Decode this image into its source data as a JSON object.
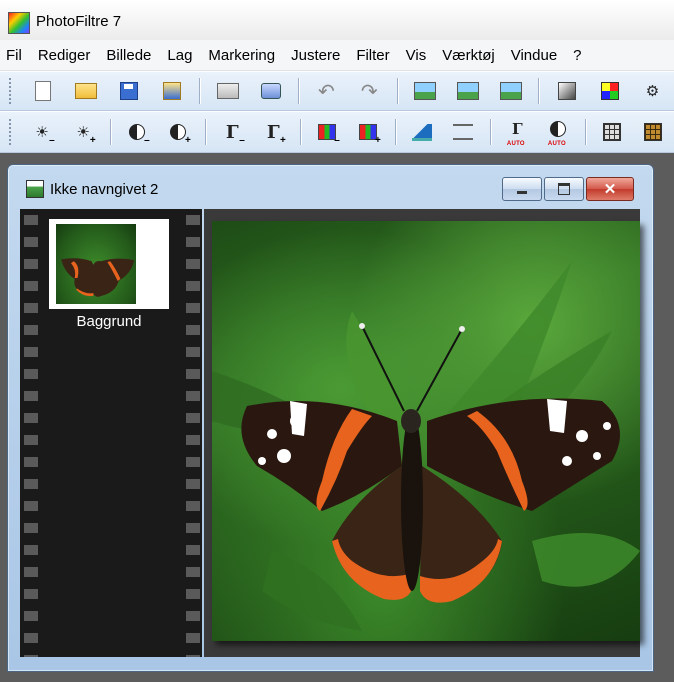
{
  "app": {
    "title": "PhotoFiltre 7"
  },
  "menu": [
    "Fil",
    "Rediger",
    "Billede",
    "Lag",
    "Markering",
    "Justere",
    "Filter",
    "Vis",
    "Værktøj",
    "Vindue",
    "?"
  ],
  "toolbar1": [
    {
      "icon": "new-document-icon"
    },
    {
      "icon": "open-folder-icon"
    },
    {
      "icon": "save-disk-icon"
    },
    {
      "icon": "save-as-icon"
    },
    {
      "icon": "print-icon"
    },
    {
      "icon": "scanner-icon"
    },
    {
      "icon": "undo-icon"
    },
    {
      "icon": "redo-icon"
    },
    {
      "icon": "image-paste-icon"
    },
    {
      "icon": "image-copy-icon"
    },
    {
      "icon": "image-new-icon"
    },
    {
      "icon": "gradient-icon"
    },
    {
      "icon": "palette-icon"
    },
    {
      "icon": "plugin-icon"
    }
  ],
  "toolbar2": [
    {
      "icon": "brightness-minus-icon"
    },
    {
      "icon": "brightness-plus-icon"
    },
    {
      "icon": "contrast-minus-icon"
    },
    {
      "icon": "contrast-plus-icon"
    },
    {
      "icon": "gamma-minus-icon"
    },
    {
      "icon": "gamma-plus-icon"
    },
    {
      "icon": "saturation-minus-icon"
    },
    {
      "icon": "saturation-plus-icon"
    },
    {
      "icon": "histogram-icon"
    },
    {
      "icon": "levels-icon"
    },
    {
      "icon": "auto-gamma-icon",
      "badge": "AUTO"
    },
    {
      "icon": "auto-contrast-icon",
      "badge": "AUTO"
    },
    {
      "icon": "grid-icon"
    },
    {
      "icon": "mosaic-icon"
    }
  ],
  "document": {
    "title": "Ikke navngivet 2",
    "window_buttons": {
      "minimize": "minimize-icon",
      "maximize": "maximize-icon",
      "close": "close-icon"
    }
  },
  "layers": [
    {
      "name": "Baggrund"
    }
  ],
  "colors": {
    "toolbar": "#d6e5f5",
    "window_frame": "#a9c6e6",
    "close_button": "#c23b2c",
    "film_strip": "#1a1a1a"
  }
}
